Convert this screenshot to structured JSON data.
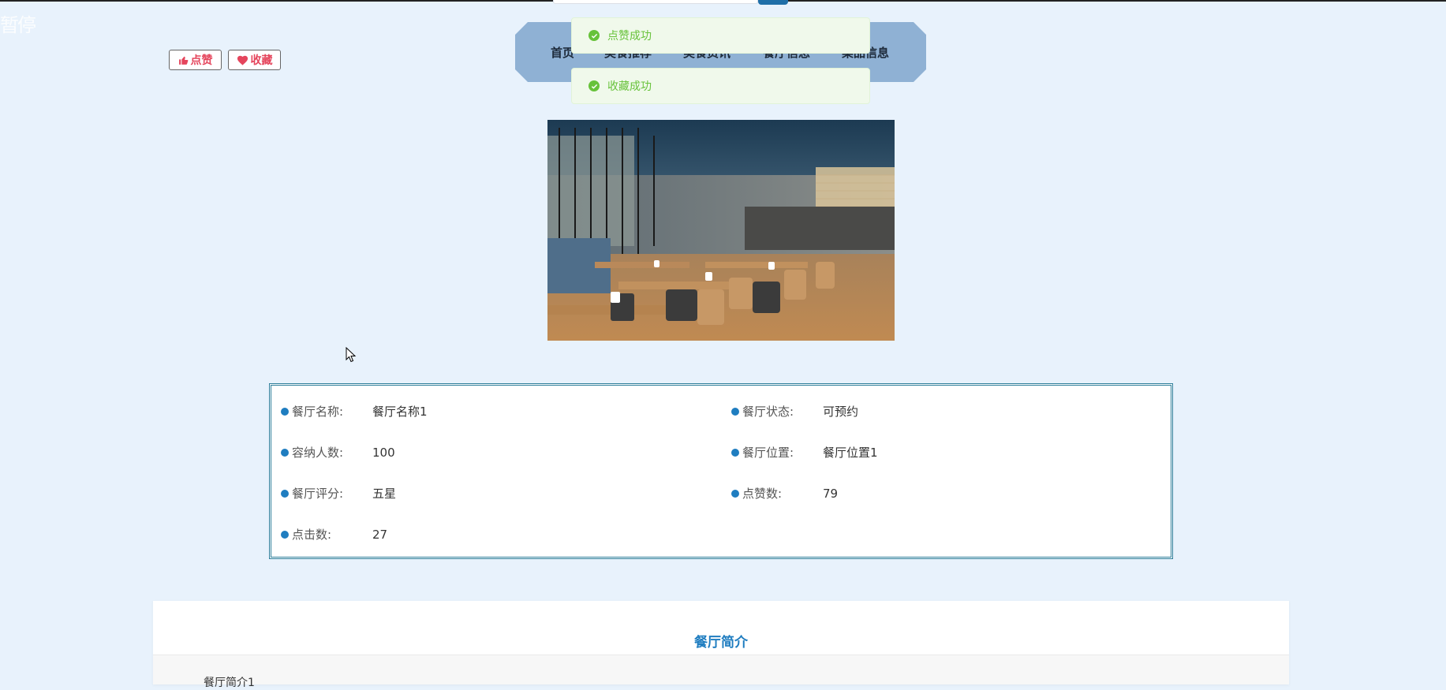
{
  "corner": {
    "text": "暂停"
  },
  "actions": {
    "like_label": "点赞",
    "favorite_label": "收藏",
    "accent": "#e5455c"
  },
  "nav": {
    "items": [
      "首页",
      "美食推荐",
      "美食资讯",
      "餐厅信息",
      "菜品信息"
    ],
    "background": "#8fb1d4"
  },
  "toasts": [
    {
      "message": "点赞成功",
      "icon": "check-circle-icon"
    },
    {
      "message": "收藏成功",
      "icon": "check-circle-icon"
    }
  ],
  "details": {
    "name": {
      "label": "餐厅名称:",
      "value": "餐厅名称1"
    },
    "status": {
      "label": "餐厅状态:",
      "value": "可预约"
    },
    "capacity": {
      "label": "容纳人数:",
      "value": "100"
    },
    "location": {
      "label": "餐厅位置:",
      "value": "餐厅位置1"
    },
    "rating": {
      "label": "餐厅评分:",
      "value": "五星"
    },
    "likes": {
      "label": "点赞数:",
      "value": "79"
    },
    "clicks": {
      "label": "点击数:",
      "value": "27"
    }
  },
  "intro": {
    "title": "餐厅简介",
    "body": "餐厅简介1"
  },
  "colors": {
    "page_bg": "#e8f2fc",
    "dot": "#1f7dc0",
    "toast_green": "#67c23a"
  }
}
